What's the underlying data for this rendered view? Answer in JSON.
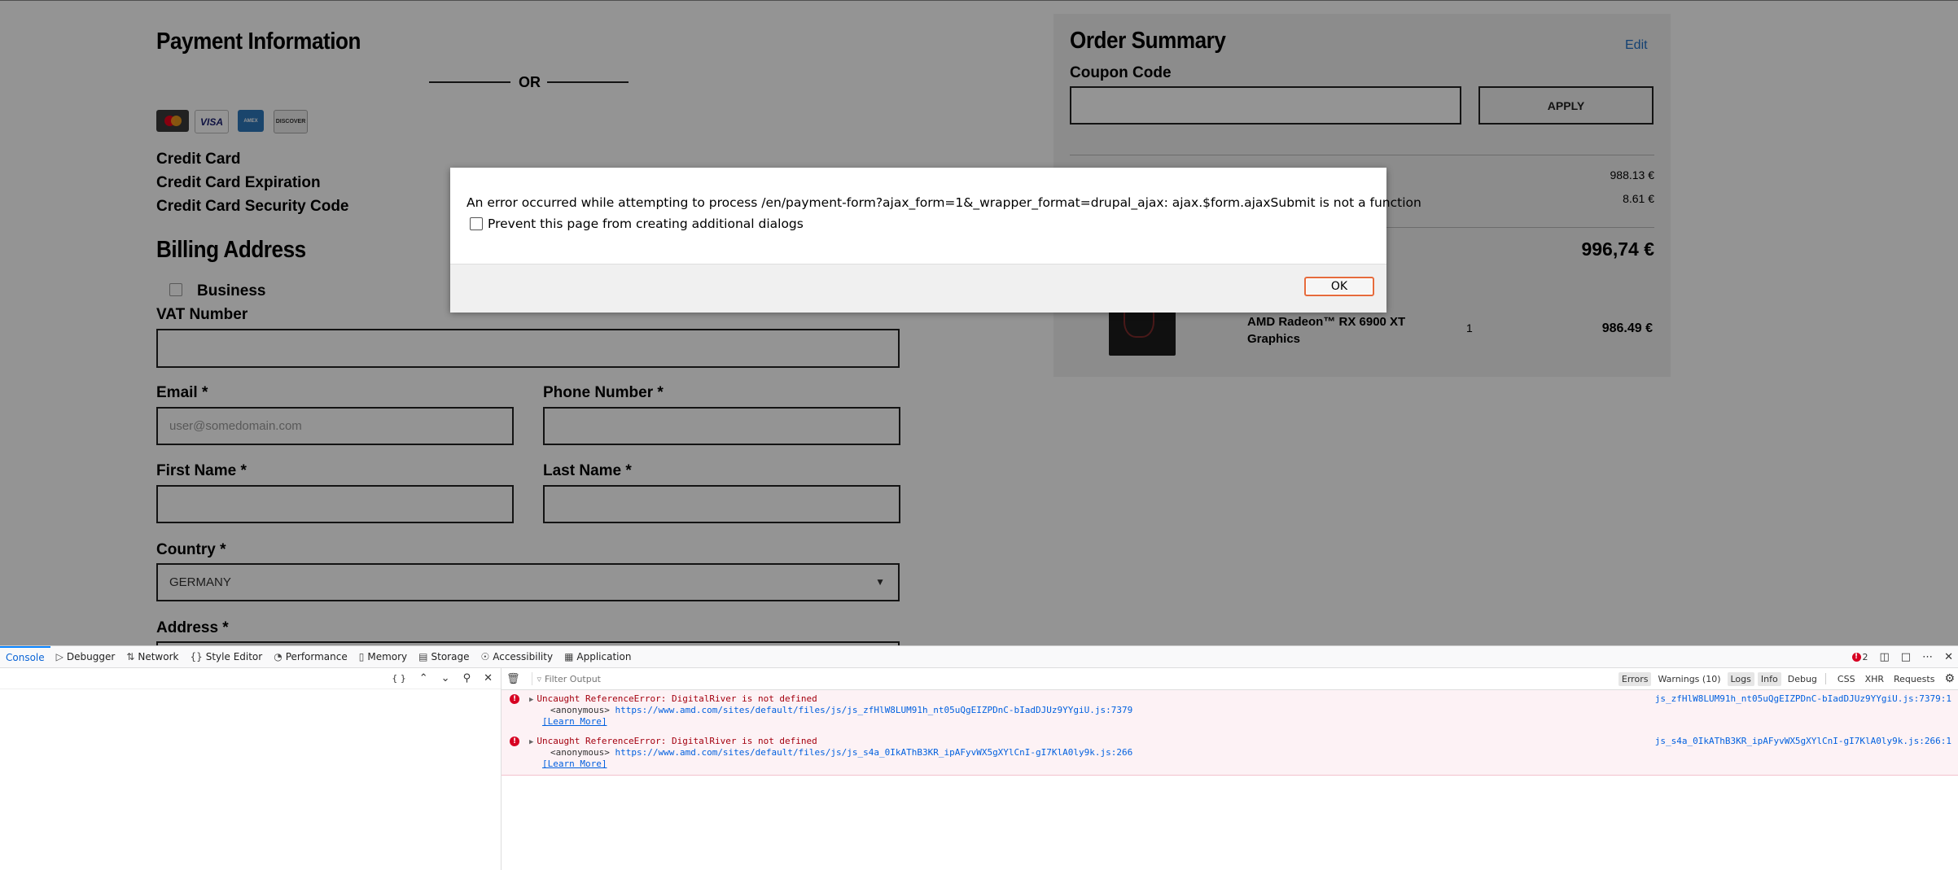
{
  "payment": {
    "title": "Payment Information",
    "or_text": "OR",
    "cards": [
      "Mastercard",
      "VISA",
      "AMEX",
      "DISCOVER"
    ],
    "credit_card_label": "Credit Card",
    "expiration_label": "Credit Card Expiration",
    "security_label": "Credit Card Security Code"
  },
  "billing": {
    "title": "Billing Address",
    "business_label": "Business",
    "vat_label": "VAT Number",
    "email_label": "Email *",
    "email_placeholder": "user@somedomain.com",
    "phone_label": "Phone Number *",
    "first_name_label": "First Name *",
    "last_name_label": "Last Name *",
    "country_label": "Country *",
    "country_value": "GERMANY",
    "address_label": "Address *"
  },
  "summary": {
    "title": "Order Summary",
    "edit_label": "Edit",
    "coupon_label": "Coupon Code",
    "apply_label": "APPLY",
    "subtotal_value": "988.13 €",
    "shipping_value": "8.61 €",
    "total_value": "996,74 €",
    "product_name_line1": "AMD Radeon™ RX 6900 XT",
    "product_name_line2": "Graphics",
    "product_qty": "1",
    "product_price": "986.49 €"
  },
  "dialog": {
    "message": "An error occurred while attempting to process /en/payment-form?ajax_form=1&_wrapper_format=drupal_ajax: ajax.$form.ajaxSubmit is not a function",
    "checkbox_label": "Prevent this page from creating additional dialogs",
    "ok_label": "OK"
  },
  "devtools": {
    "tabs": [
      {
        "label": "Console",
        "icon": "console-icon"
      },
      {
        "label": "Debugger",
        "icon": "debugger-icon"
      },
      {
        "label": "Network",
        "icon": "network-icon"
      },
      {
        "label": "Style Editor",
        "icon": "braces-icon"
      },
      {
        "label": "Performance",
        "icon": "gauge-icon"
      },
      {
        "label": "Memory",
        "icon": "memory-icon"
      },
      {
        "label": "Storage",
        "icon": "storage-icon"
      },
      {
        "label": "Accessibility",
        "icon": "accessibility-icon"
      },
      {
        "label": "Application",
        "icon": "grid-icon"
      }
    ],
    "error_count": "2",
    "filter_placeholder": "Filter Output",
    "filters": {
      "errors": "Errors",
      "warnings": "Warnings (10)",
      "logs": "Logs",
      "info": "Info",
      "debug": "Debug",
      "css": "CSS",
      "xhr": "XHR",
      "requests": "Requests"
    },
    "logs": [
      {
        "message": "Uncaught ReferenceError: DigitalRiver is not defined",
        "frame": "<anonymous>",
        "url": "https://www.amd.com/sites/default/files/js/js_zfHlW8LUM91h_nt05uQgEIZPDnC-bIadDJUz9YYgiU.js:7379",
        "learn_more": "[Learn More]",
        "source": "js_zfHlW8LUM91h_nt05uQgEIZPDnC-bIadDJUz9YYgiU.js:7379:1"
      },
      {
        "message": "Uncaught ReferenceError: DigitalRiver is not defined",
        "frame": "<anonymous>",
        "url": "https://www.amd.com/sites/default/files/js/js_s4a_0IkAThB3KR_ipAFyvWX5gXYlCnI-gI7KlA0ly9k.js:266",
        "learn_more": "[Learn More]",
        "source": "js_s4a_0IkAThB3KR_ipAFyvWX5gXYlCnI-gI7KlA0ly9k.js:266:1"
      }
    ]
  }
}
